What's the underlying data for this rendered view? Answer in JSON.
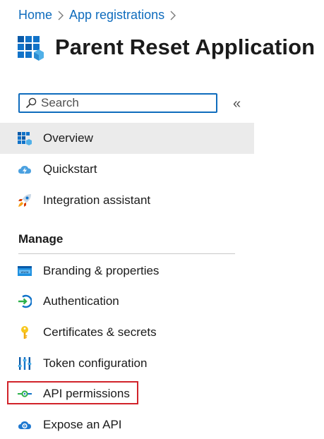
{
  "breadcrumb": {
    "items": [
      "Home",
      "App registrations"
    ]
  },
  "page": {
    "title": "Parent Reset Application",
    "icon": "app-registration-grid-icon"
  },
  "search": {
    "placeholder": "Search",
    "value": ""
  },
  "collapse": {
    "label": "«",
    "icon": "double-chevron-left-icon"
  },
  "nav": {
    "top_items": [
      {
        "label": "Overview",
        "icon": "overview-grid-icon",
        "active": true
      },
      {
        "label": "Quickstart",
        "icon": "cloud-lightning-icon",
        "active": false
      },
      {
        "label": "Integration assistant",
        "icon": "rocket-icon",
        "active": false
      }
    ],
    "manage_header": "Manage",
    "manage_items": [
      {
        "label": "Branding & properties",
        "icon": "www-window-icon"
      },
      {
        "label": "Authentication",
        "icon": "sign-in-arrow-icon"
      },
      {
        "label": "Certificates & secrets",
        "icon": "key-icon"
      },
      {
        "label": "Token configuration",
        "icon": "token-bars-icon"
      },
      {
        "label": "API permissions",
        "icon": "api-permissions-icon",
        "highlighted": true
      },
      {
        "label": "Expose an API",
        "icon": "cloud-gear-icon"
      }
    ]
  },
  "colors": {
    "link": "#0f6cbd",
    "active_bg": "#ebebeb",
    "highlight": "#d1232a"
  }
}
